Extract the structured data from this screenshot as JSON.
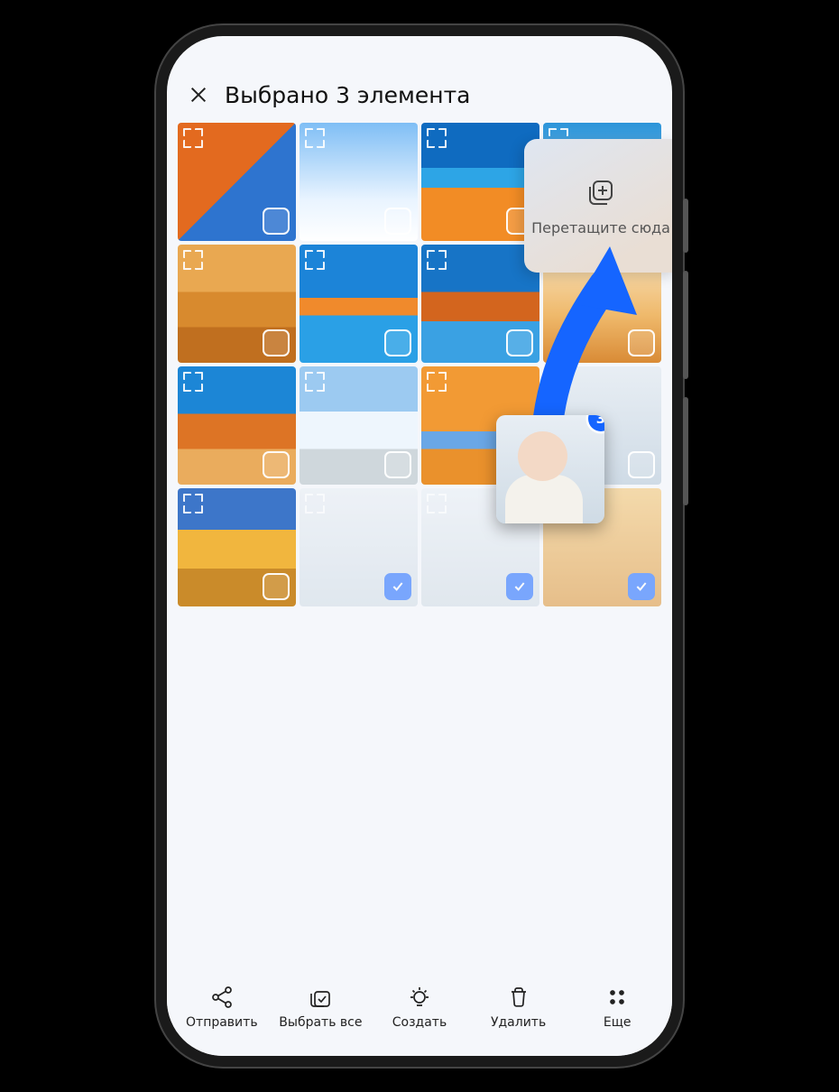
{
  "header": {
    "title": "Выбрано 3 элемента"
  },
  "drop_target": {
    "label": "Перетащите сюда"
  },
  "drag": {
    "count": "3"
  },
  "grid": {
    "items": [
      {
        "selected": false
      },
      {
        "selected": false
      },
      {
        "selected": false
      },
      {
        "selected": false
      },
      {
        "selected": false
      },
      {
        "selected": false
      },
      {
        "selected": false
      },
      {
        "selected": false
      },
      {
        "selected": false
      },
      {
        "selected": false
      },
      {
        "selected": false
      },
      {
        "selected": false
      },
      {
        "selected": false
      },
      {
        "selected": true
      },
      {
        "selected": true
      },
      {
        "selected": true
      }
    ]
  },
  "actions": {
    "send": "Отправить",
    "select": "Выбрать все",
    "create": "Создать",
    "delete": "Удалить",
    "more": "Еще"
  }
}
